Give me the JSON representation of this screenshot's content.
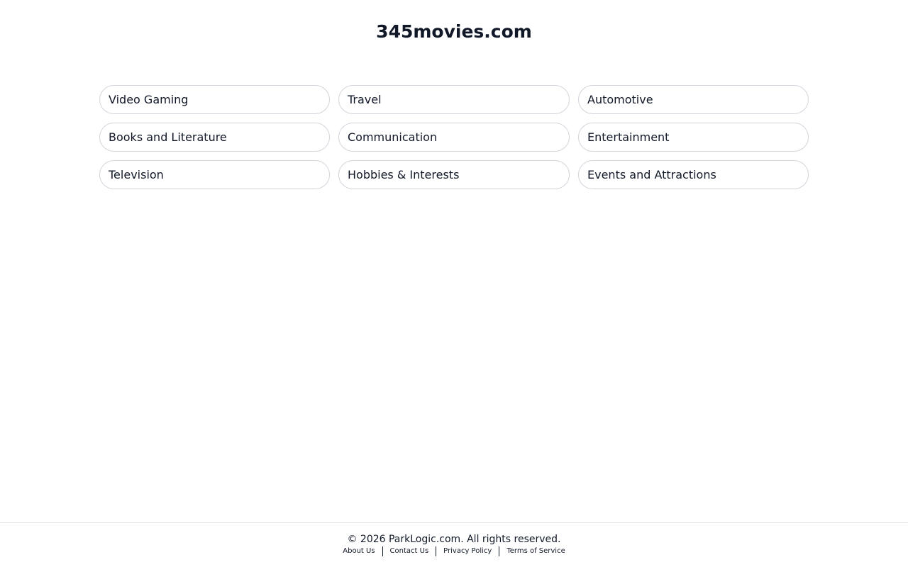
{
  "header": {
    "site_title": "345movies.com"
  },
  "categories": [
    "Video Gaming",
    "Travel",
    "Automotive",
    "Books and Literature",
    "Communication",
    "Entertainment",
    "Television",
    "Hobbies & Interests",
    "Events and Attractions"
  ],
  "footer": {
    "copyright": "© 2026 ParkLogic.com. All rights reserved.",
    "links": [
      "About Us",
      "Contact Us",
      "Privacy Policy",
      "Terms of Service"
    ]
  }
}
